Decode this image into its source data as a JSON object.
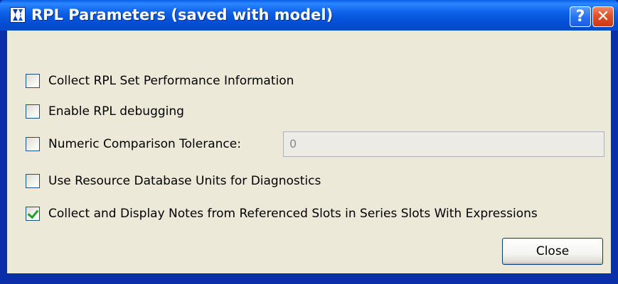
{
  "window": {
    "title": "RPL Parameters (saved with model)",
    "help_label": "?",
    "close_label": "✕"
  },
  "options": [
    {
      "label": "Collect RPL Set Performance Information",
      "checked": false
    },
    {
      "label": "Enable RPL debugging",
      "checked": false
    },
    {
      "label": "Numeric Comparison Tolerance:",
      "checked": false
    },
    {
      "label": "Use Resource Database Units for Diagnostics",
      "checked": false
    },
    {
      "label": "Collect and Display Notes from Referenced Slots in Series Slots With Expressions",
      "checked": true
    }
  ],
  "tolerance_field": {
    "value": "0"
  },
  "buttons": {
    "close_label": "Close"
  },
  "colors": {
    "titlebar": "#0550d6",
    "panel": "#ece9d8",
    "check": "#21a121"
  },
  "icons": {
    "app": "riverware-r-icon",
    "help": "help-icon",
    "close": "close-icon"
  }
}
